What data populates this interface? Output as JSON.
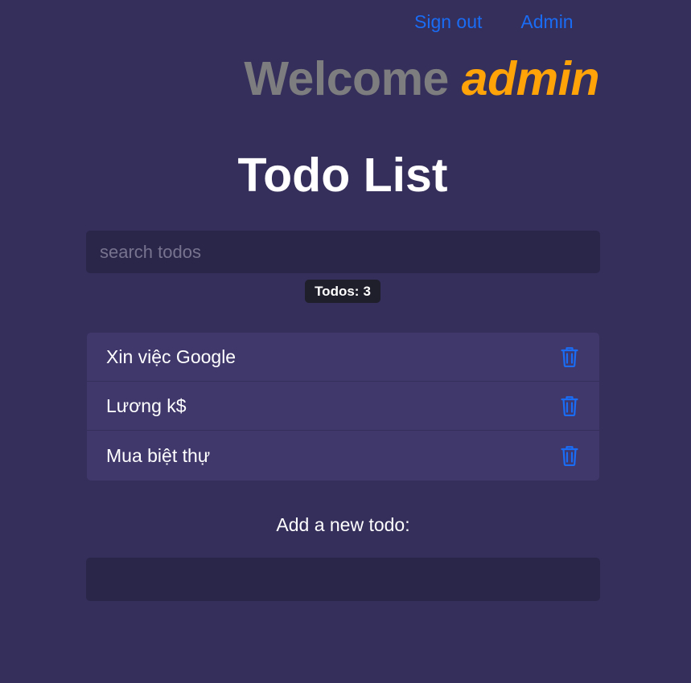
{
  "nav": {
    "sign_out": "Sign out",
    "admin": "Admin"
  },
  "welcome": {
    "greeting": "Welcome",
    "username": "admin"
  },
  "title": "Todo List",
  "search": {
    "placeholder": "search todos",
    "value": ""
  },
  "count": {
    "label": "Todos:",
    "value": "3"
  },
  "todos": [
    {
      "text": "Xin việc Google",
      "icon": "trash-icon"
    },
    {
      "text": "Lương k$",
      "icon": "trash-icon"
    },
    {
      "text": "Mua biệt thự",
      "icon": "trash-icon"
    }
  ],
  "add": {
    "label": "Add a new todo:",
    "value": ""
  },
  "colors": {
    "background": "#352f5b",
    "link": "#1a6cf5",
    "username": "#ffa308",
    "greeting": "#7d7d7f",
    "item_background": "#40386b",
    "input_background": "#29264a"
  }
}
